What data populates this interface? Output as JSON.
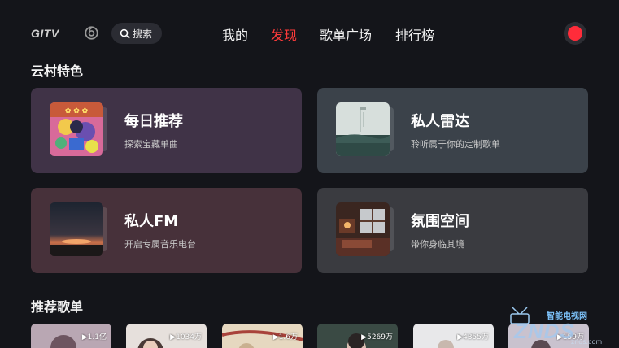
{
  "header": {
    "logo_text": "GITV",
    "search_label": "搜索",
    "tabs": [
      {
        "label": "我的",
        "active": false
      },
      {
        "label": "发现",
        "active": true
      },
      {
        "label": "歌单广场",
        "active": false
      },
      {
        "label": "排行榜",
        "active": false
      }
    ],
    "accent_color": "#ff3b3b",
    "record_color": "#ff2c3a"
  },
  "features": {
    "section_title": "云村特色",
    "cards": [
      {
        "title": "每日推荐",
        "subtitle": "探索宝藏单曲",
        "icon": "daily-cover-art"
      },
      {
        "title": "私人雷达",
        "subtitle": "聆听属于你的定制歌单",
        "icon": "radar-cover-art"
      },
      {
        "title": "私人FM",
        "subtitle": "开启专属音乐电台",
        "icon": "fm-sunset-cover-art"
      },
      {
        "title": "氛围空间",
        "subtitle": "带你身临其境",
        "icon": "ambient-room-cover-art"
      }
    ]
  },
  "playlists": {
    "section_title": "推荐歌单",
    "items": [
      {
        "count": "▶1.1亿"
      },
      {
        "count": "▶1034万"
      },
      {
        "count": "▶1.6万"
      },
      {
        "count": "▶5269万"
      },
      {
        "count": "▶4355万"
      },
      {
        "count": "▶159万"
      }
    ]
  },
  "watermark": {
    "top": "智能电视网",
    "main": "ZNDS",
    "url": "znds.com"
  }
}
